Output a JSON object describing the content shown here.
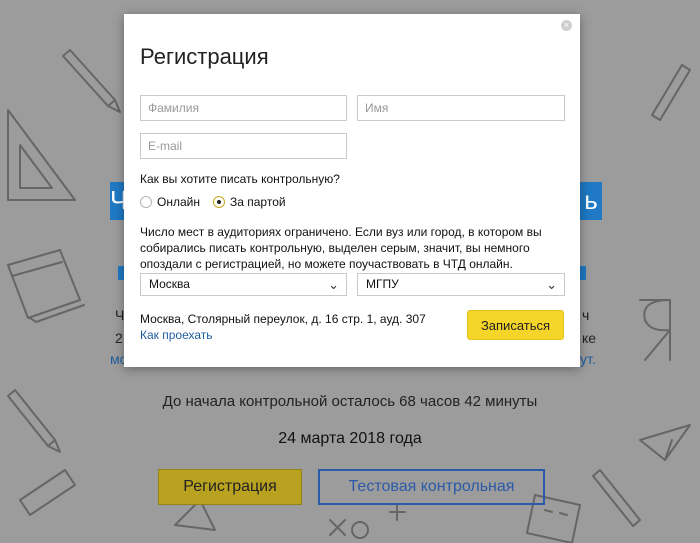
{
  "modal": {
    "title": "Регистрация",
    "close_glyph": "×",
    "surname_placeholder": "Фамилия",
    "name_placeholder": "Имя",
    "email_placeholder": "E-mail",
    "question": "Как вы хотите писать контрольную?",
    "option_online": "Онлайн",
    "option_desk": "За партой",
    "selected_option": "За партой",
    "info": "Число мест в аудиториях ограничено. Если вуз или город, в котором вы собирались писать контрольную, выделен серым, значит, вы немного опоздали с регистрацией, но можете поучаствовать в ЧТД онлайн.",
    "city_value": "Москва",
    "venue_value": "МГПУ",
    "address": "Москва, Столярный переулок, д. 16 стр. 1, ауд. 307",
    "directions_link": "Как проехать",
    "submit_label": "Записаться",
    "accent_color": "#f5d52a"
  },
  "background": {
    "banner_left": "Ч",
    "banner_right": "ь",
    "fragment_left_1": "Ч",
    "fragment_left_2": "2",
    "fragment_left_3": "мо",
    "fragment_right_1": "ч",
    "fragment_right_2": "ке",
    "fragment_right_3": "ут.",
    "countdown": "До начала контрольной осталось 68 часов 42 минуты",
    "date": "24 марта 2018 года",
    "register_button": "Регистрация",
    "test_button": "Тестовая контрольная",
    "brand_color": "#1f79c4"
  }
}
